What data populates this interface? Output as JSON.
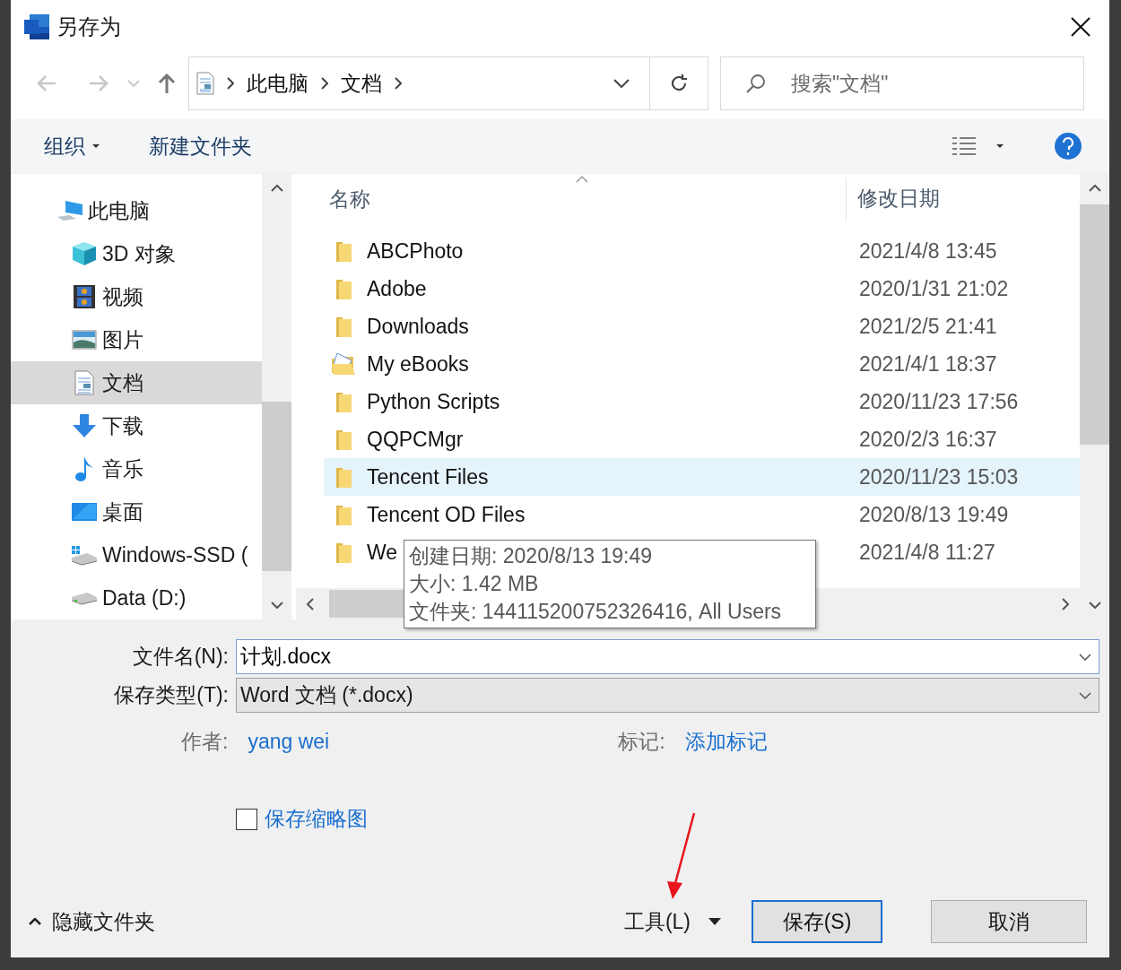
{
  "window": {
    "title": "另存为"
  },
  "nav": {
    "breadcrumb": [
      {
        "label": "此电脑"
      },
      {
        "label": "文档"
      }
    ],
    "search": {
      "placeholder": "搜索\"文档\""
    }
  },
  "toolbar": {
    "organize": "组织",
    "new_folder": "新建文件夹"
  },
  "sidebar": {
    "items": [
      {
        "label": "此电脑",
        "kind": "computer",
        "selected": false,
        "children": [
          {
            "label": "3D 对象",
            "kind": "cube",
            "selected": false
          },
          {
            "label": "视频",
            "kind": "video",
            "selected": false
          },
          {
            "label": "图片",
            "kind": "pictures",
            "selected": false
          },
          {
            "label": "文档",
            "kind": "documents",
            "selected": true
          },
          {
            "label": "下载",
            "kind": "download",
            "selected": false
          },
          {
            "label": "音乐",
            "kind": "music",
            "selected": false
          },
          {
            "label": "桌面",
            "kind": "desktop",
            "selected": false
          },
          {
            "label": "Windows-SSD (",
            "kind": "systemdrive",
            "selected": false
          },
          {
            "label": "Data (D:)",
            "kind": "drive",
            "selected": false
          }
        ]
      }
    ]
  },
  "file_list": {
    "columns": [
      "名称",
      "修改日期"
    ],
    "rows": [
      {
        "name": "ABCPhoto",
        "date": "2021/4/8 13:45",
        "kind": "folder",
        "selected": false
      },
      {
        "name": "Adobe",
        "date": "2020/1/31 21:02",
        "kind": "folder",
        "selected": false
      },
      {
        "name": "Downloads",
        "date": "2021/2/5 21:41",
        "kind": "folder",
        "selected": false
      },
      {
        "name": "My eBooks",
        "date": "2021/4/1 18:37",
        "kind": "special",
        "selected": false
      },
      {
        "name": "Python Scripts",
        "date": "2020/11/23 17:56",
        "kind": "folder",
        "selected": false
      },
      {
        "name": "QQPCMgr",
        "date": "2020/2/3 16:37",
        "kind": "folder",
        "selected": false
      },
      {
        "name": "Tencent Files",
        "date": "2020/11/23 15:03",
        "kind": "folder",
        "selected": true
      },
      {
        "name": "Tencent OD Files",
        "date": "2020/8/13 19:49",
        "kind": "folder",
        "selected": false
      },
      {
        "name": "We",
        "date": "2021/4/8 11:27",
        "kind": "folder",
        "selected": false
      }
    ]
  },
  "tooltip": {
    "lines": [
      "创建日期: 2020/8/13 19:49",
      "大小: 1.42 MB",
      "文件夹: 144115200752326416, All Users"
    ]
  },
  "form": {
    "filename_label": "文件名(N):",
    "filename": "计划.docx",
    "type_label": "保存类型(T):",
    "type": "Word 文档 (*.docx)",
    "author_label": "作者:",
    "author": "yang wei",
    "tags_label": "标记:",
    "tags": "添加标记",
    "thumbnail": {
      "label": "保存缩略图",
      "checked": false
    }
  },
  "footer": {
    "hide_folders": "隐藏文件夹",
    "tools": "工具(L)",
    "save": "保存(S)",
    "cancel": "取消"
  }
}
